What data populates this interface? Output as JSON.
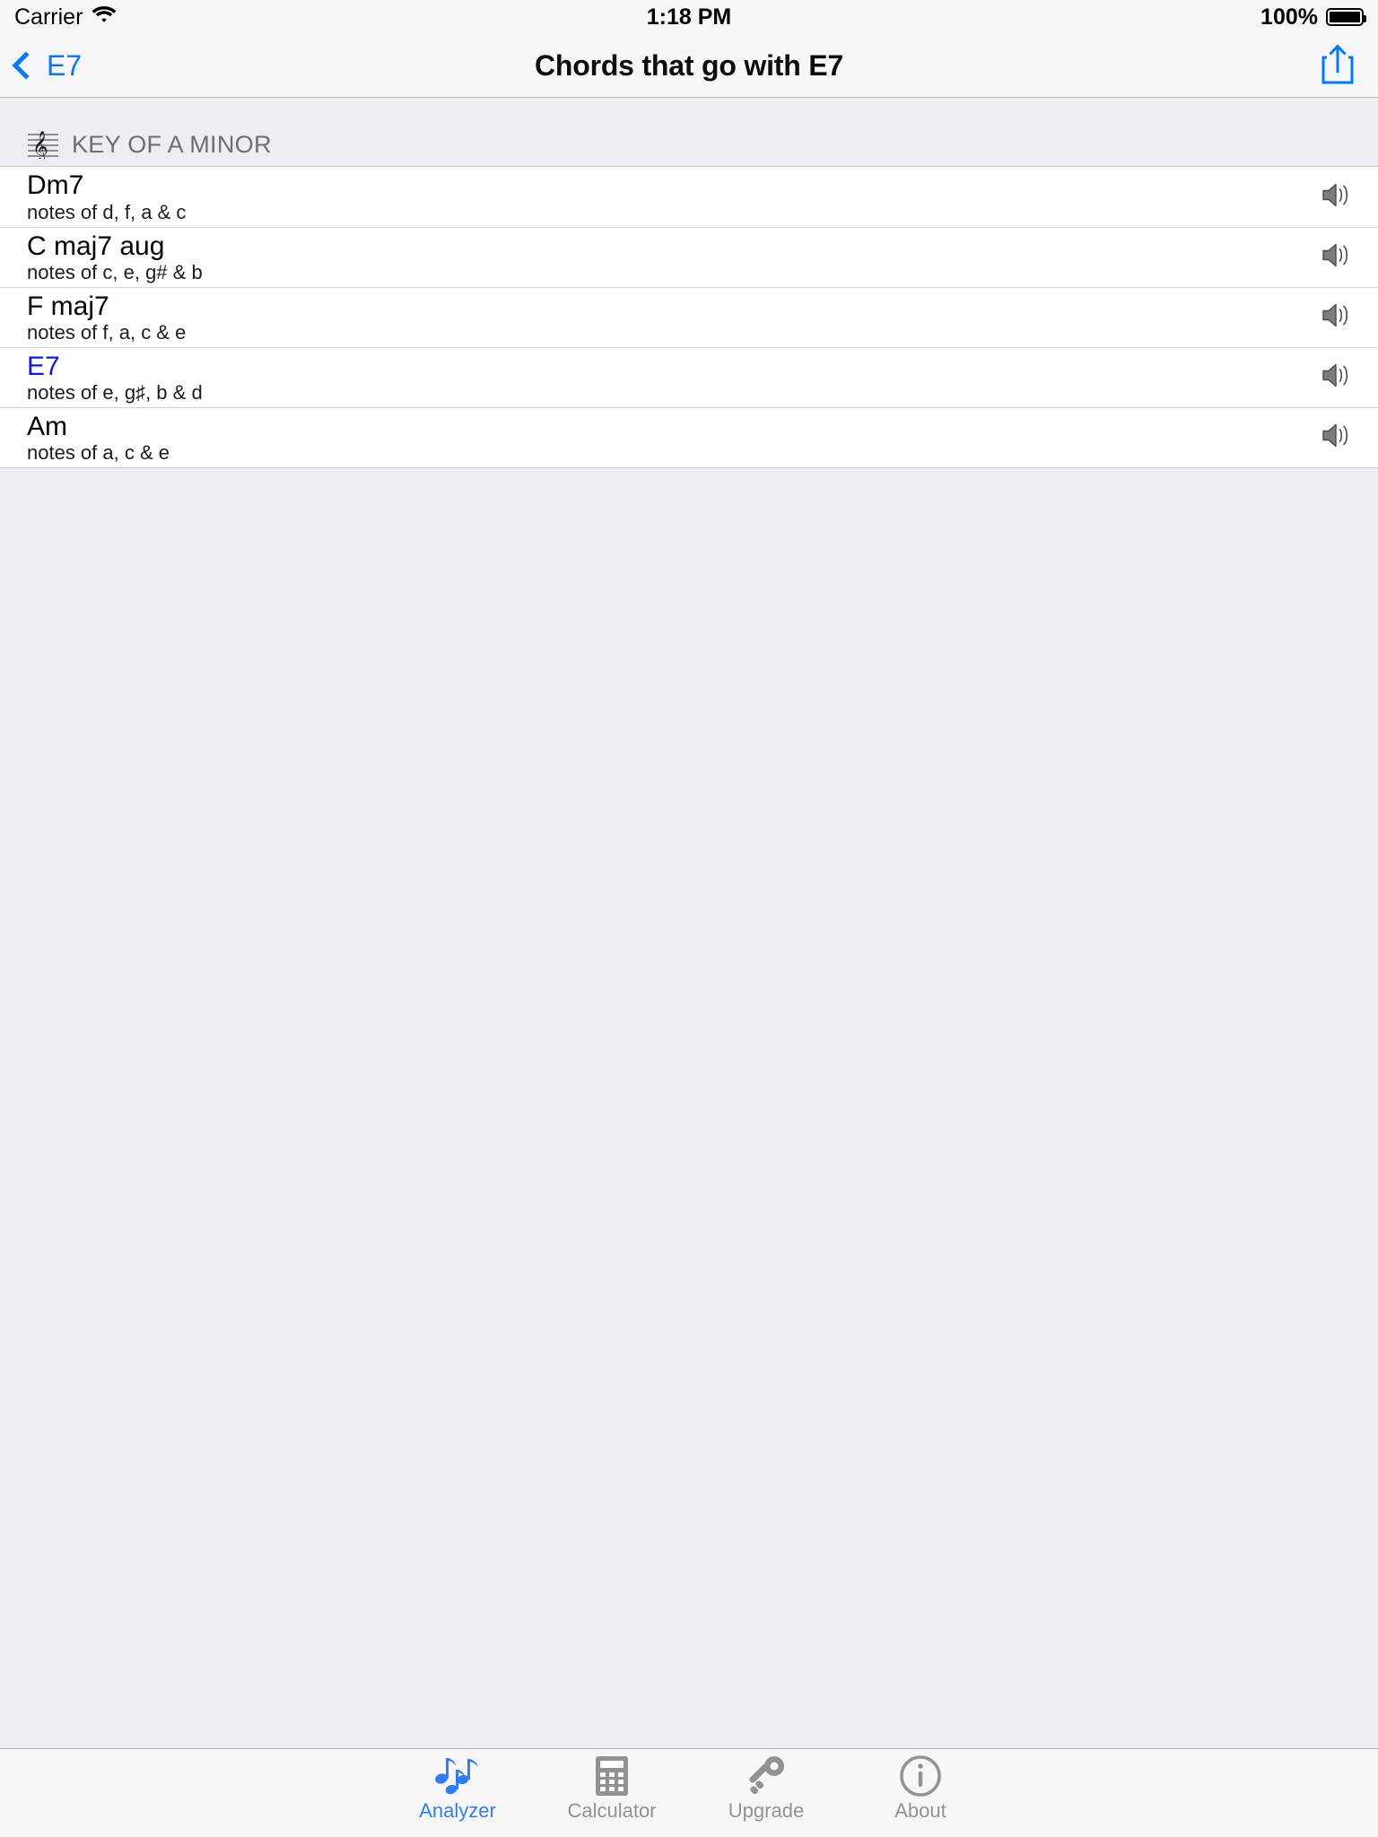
{
  "status_bar": {
    "carrier": "Carrier",
    "wifi_icon": "wifi-icon",
    "time": "1:18 PM",
    "battery_percent": "100%",
    "battery_icon": "battery-full-icon"
  },
  "nav_bar": {
    "back_label": "E7",
    "back_icon": "chevron-left-icon",
    "title": "Chords that go with E7",
    "share_icon": "share-icon"
  },
  "section": {
    "icon": "treble-clef-staff-icon",
    "title": "KEY OF A MINOR"
  },
  "rows": [
    {
      "title": "Dm7",
      "subtitle": "notes of d, f, a & c",
      "accent": false,
      "speaker_icon": "speaker-icon"
    },
    {
      "title": "C maj7 aug",
      "subtitle": "notes of c, e, g# & b",
      "accent": false,
      "speaker_icon": "speaker-icon"
    },
    {
      "title": "F maj7",
      "subtitle": "notes of f, a, c & e",
      "accent": false,
      "speaker_icon": "speaker-icon"
    },
    {
      "title": "E7",
      "subtitle": "notes of e, g♯, b & d",
      "accent": true,
      "speaker_icon": "speaker-icon"
    },
    {
      "title": "Am",
      "subtitle": "notes of a, c & e",
      "accent": false,
      "speaker_icon": "speaker-icon"
    }
  ],
  "tabs": [
    {
      "label": "Analyzer",
      "icon": "music-notes-icon",
      "active": true
    },
    {
      "label": "Calculator",
      "icon": "calculator-icon",
      "active": false
    },
    {
      "label": "Upgrade",
      "icon": "key-icon",
      "active": false
    },
    {
      "label": "About",
      "icon": "info-circle-icon",
      "active": false
    }
  ],
  "colors": {
    "accent_blue": "#007aff",
    "link_blue": "#1414e6",
    "tab_active": "#2f7cf6",
    "tab_inactive": "#929296",
    "page_bg": "#eeedf3",
    "bar_bg": "#f7f7f9"
  }
}
